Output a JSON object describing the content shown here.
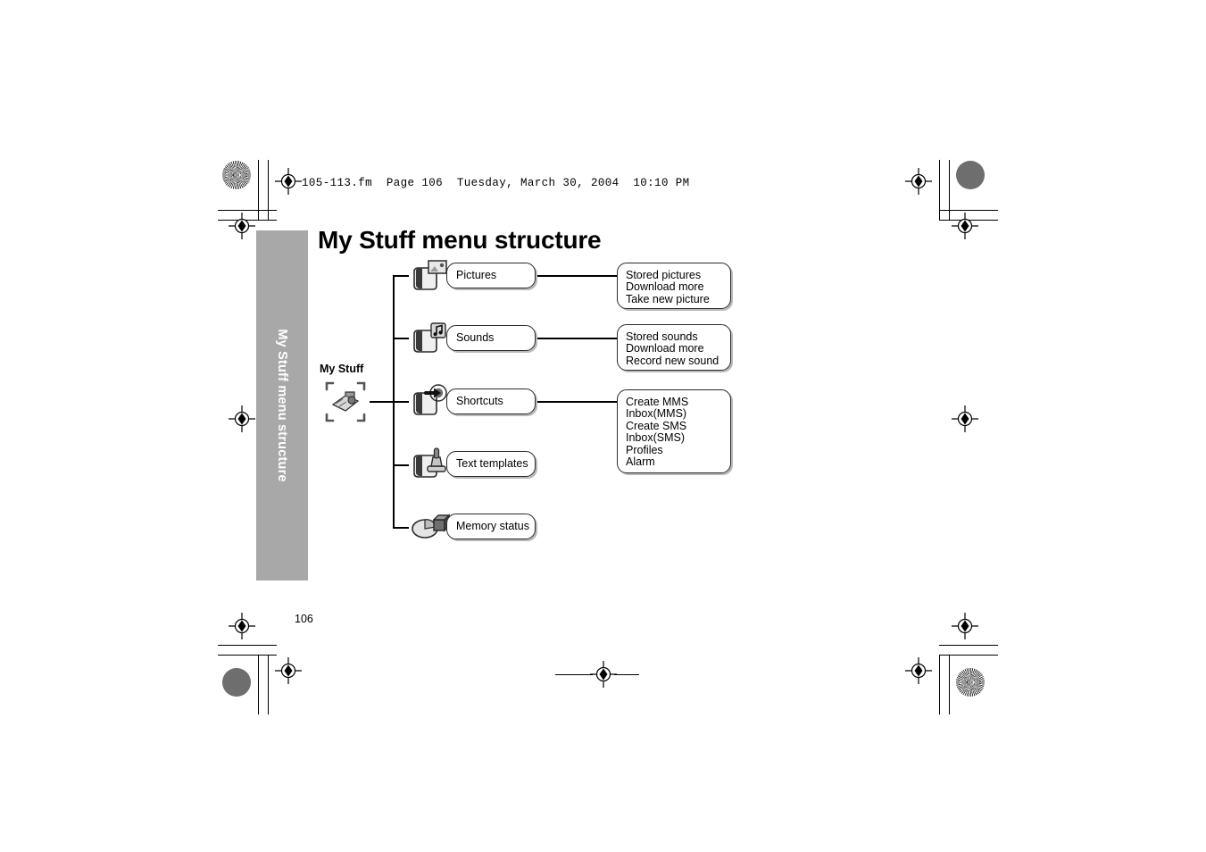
{
  "slug_line": "105-113.fm  Page 106  Tuesday, March 30, 2004  10:10 PM",
  "page_number": "106",
  "side_tab": {
    "label": "My Stuff menu structure"
  },
  "title": "My Stuff menu structure",
  "root": {
    "label": "My Stuff",
    "icon": "my-stuff-bracket-icon"
  },
  "nodes": [
    {
      "label": "Pictures",
      "icon": "folder-picture-icon",
      "details": [
        "Stored pictures",
        "Download more",
        "Take new picture"
      ]
    },
    {
      "label": "Sounds",
      "icon": "folder-music-note-icon",
      "details": [
        "Stored sounds",
        "Download more",
        "Record new sound"
      ]
    },
    {
      "label": "Shortcuts",
      "icon": "folder-arrow-icon",
      "details": [
        "Create MMS",
        "Inbox(MMS)",
        "Create SMS",
        "Inbox(SMS)",
        "Profiles",
        "Alarm"
      ]
    },
    {
      "label": "Text templates",
      "icon": "folder-stamp-icon",
      "details": []
    },
    {
      "label": "Memory status",
      "icon": "memory-pie-icon",
      "details": []
    }
  ],
  "colors": {
    "side_tab_bg": "#a8a8a8",
    "side_tab_text": "#ffffff",
    "box_border": "#2b2b2b",
    "box_shadow": "#b9b9b9",
    "ink": "#000000",
    "page_bg": "#ffffff"
  }
}
